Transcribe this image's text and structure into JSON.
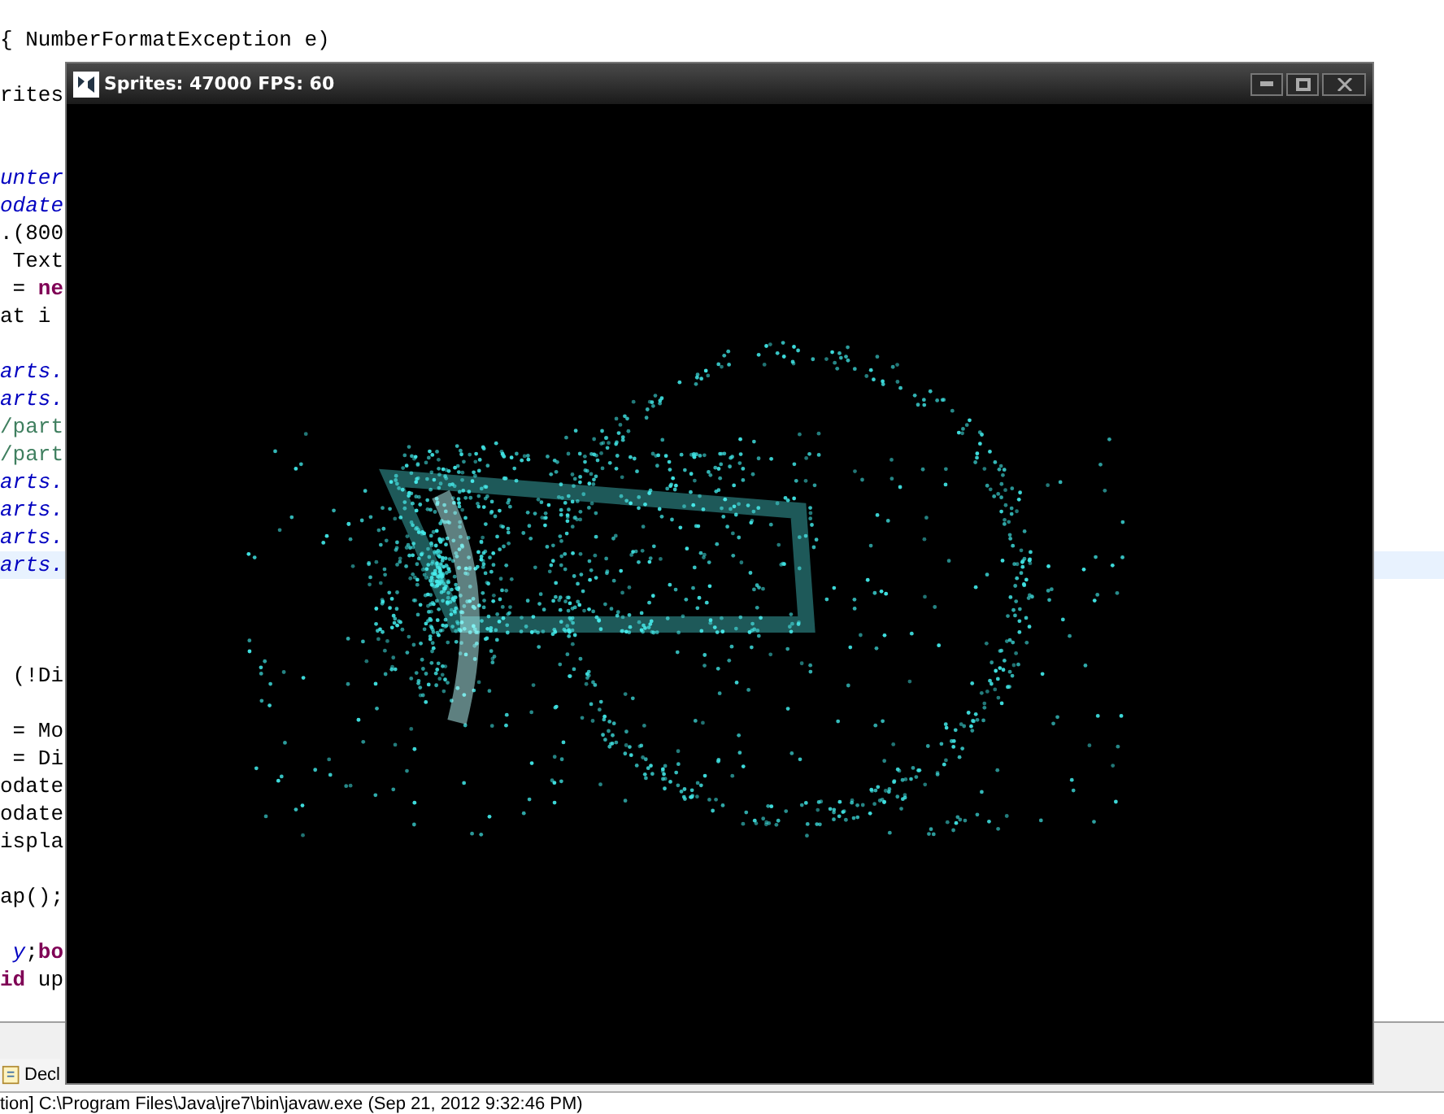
{
  "editor": {
    "lines": [
      {
        "kind": "code",
        "segments": [
          {
            "text": "{ NumberFormatException e)",
            "kind": "plain"
          }
        ]
      },
      {
        "kind": "blank"
      },
      {
        "kind": "code",
        "segments": [
          {
            "text": "rites",
            "kind": "plain"
          }
        ]
      },
      {
        "kind": "blank"
      },
      {
        "kind": "blank"
      },
      {
        "kind": "code",
        "segments": [
          {
            "text": "unter",
            "kind": "field"
          }
        ]
      },
      {
        "kind": "code",
        "segments": [
          {
            "text": "odate",
            "kind": "field"
          }
        ]
      },
      {
        "kind": "code",
        "segments": [
          {
            "text": ".(800",
            "kind": "plain"
          }
        ]
      },
      {
        "kind": "code",
        "segments": [
          {
            "text": " Text",
            "kind": "plain"
          }
        ]
      },
      {
        "kind": "code",
        "segments": [
          {
            "text": " = ",
            "kind": "plain"
          },
          {
            "text": "ne",
            "kind": "keyword"
          }
        ]
      },
      {
        "kind": "code",
        "segments": [
          {
            "text": "at i",
            "kind": "plain"
          }
        ]
      },
      {
        "kind": "blank"
      },
      {
        "kind": "code",
        "segments": [
          {
            "text": "arts.",
            "kind": "field"
          }
        ]
      },
      {
        "kind": "code",
        "segments": [
          {
            "text": "arts.",
            "kind": "field"
          }
        ]
      },
      {
        "kind": "code",
        "segments": [
          {
            "text": "/part",
            "kind": "comment"
          }
        ]
      },
      {
        "kind": "code",
        "segments": [
          {
            "text": "/part",
            "kind": "comment"
          }
        ]
      },
      {
        "kind": "code",
        "segments": [
          {
            "text": "arts.",
            "kind": "field"
          }
        ]
      },
      {
        "kind": "code",
        "segments": [
          {
            "text": "arts.",
            "kind": "field"
          }
        ]
      },
      {
        "kind": "code",
        "segments": [
          {
            "text": "arts.",
            "kind": "field"
          }
        ]
      },
      {
        "kind": "code",
        "segments": [
          {
            "text": "arts.",
            "kind": "field"
          }
        ],
        "current": true
      },
      {
        "kind": "blank"
      },
      {
        "kind": "blank"
      },
      {
        "kind": "blank"
      },
      {
        "kind": "code",
        "segments": [
          {
            "text": " (!Di",
            "kind": "plain"
          }
        ]
      },
      {
        "kind": "blank"
      },
      {
        "kind": "code",
        "segments": [
          {
            "text": " = Mo",
            "kind": "plain"
          }
        ]
      },
      {
        "kind": "code",
        "segments": [
          {
            "text": " = Di",
            "kind": "plain"
          }
        ]
      },
      {
        "kind": "code",
        "segments": [
          {
            "text": "odate",
            "kind": "plain"
          }
        ]
      },
      {
        "kind": "code",
        "segments": [
          {
            "text": "odate",
            "kind": "plain"
          }
        ]
      },
      {
        "kind": "code",
        "segments": [
          {
            "text": "ispla",
            "kind": "plain"
          }
        ]
      },
      {
        "kind": "blank"
      },
      {
        "kind": "code",
        "segments": [
          {
            "text": "ap();",
            "kind": "plain"
          }
        ]
      },
      {
        "kind": "blank"
      },
      {
        "kind": "code",
        "segments": [
          {
            "text": " y",
            "kind": "field"
          },
          {
            "text": ";",
            "kind": "plain"
          },
          {
            "text": "bo",
            "kind": "keyword"
          }
        ]
      },
      {
        "kind": "code",
        "segments": [
          {
            "text": "id",
            "kind": "keyword"
          },
          {
            "text": " up",
            "kind": "plain"
          }
        ]
      }
    ]
  },
  "bottom_panel": {
    "tabs": [
      {
        "label": "Decl"
      }
    ],
    "console_status": "tion] C:\\Program Files\\Java\\jre7\\bin\\javaw.exe (Sep 21, 2012 9:32:46 PM)"
  },
  "app_window": {
    "title": "Sprites: 47000 FPS: 60"
  }
}
